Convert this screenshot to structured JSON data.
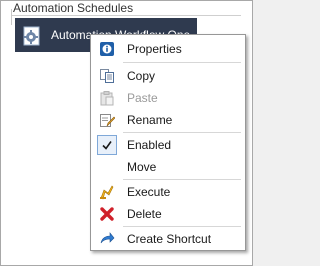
{
  "tree": {
    "header_label": "Automation Schedules",
    "selected_item_label": "Automation Workflow One"
  },
  "context_menu": {
    "items": [
      {
        "label": "Properties",
        "icon": "info-icon",
        "enabled": true
      },
      {
        "label": "Copy",
        "icon": "copy-icon",
        "enabled": true
      },
      {
        "label": "Paste",
        "icon": "paste-icon",
        "enabled": false
      },
      {
        "label": "Rename",
        "icon": "rename-icon",
        "enabled": true
      },
      {
        "label": "Enabled",
        "icon": "checkmark-icon",
        "enabled": true,
        "checked": true
      },
      {
        "label": "Move",
        "icon": "",
        "enabled": true
      },
      {
        "label": "Execute",
        "icon": "execute-icon",
        "enabled": true
      },
      {
        "label": "Delete",
        "icon": "delete-icon",
        "enabled": true
      },
      {
        "label": "Create Shortcut",
        "icon": "shortcut-icon",
        "enabled": true
      }
    ]
  },
  "colors": {
    "selection_background": "#2f3a4f",
    "delete_red": "#d0202a",
    "execute_yellow": "#f2b51d"
  }
}
